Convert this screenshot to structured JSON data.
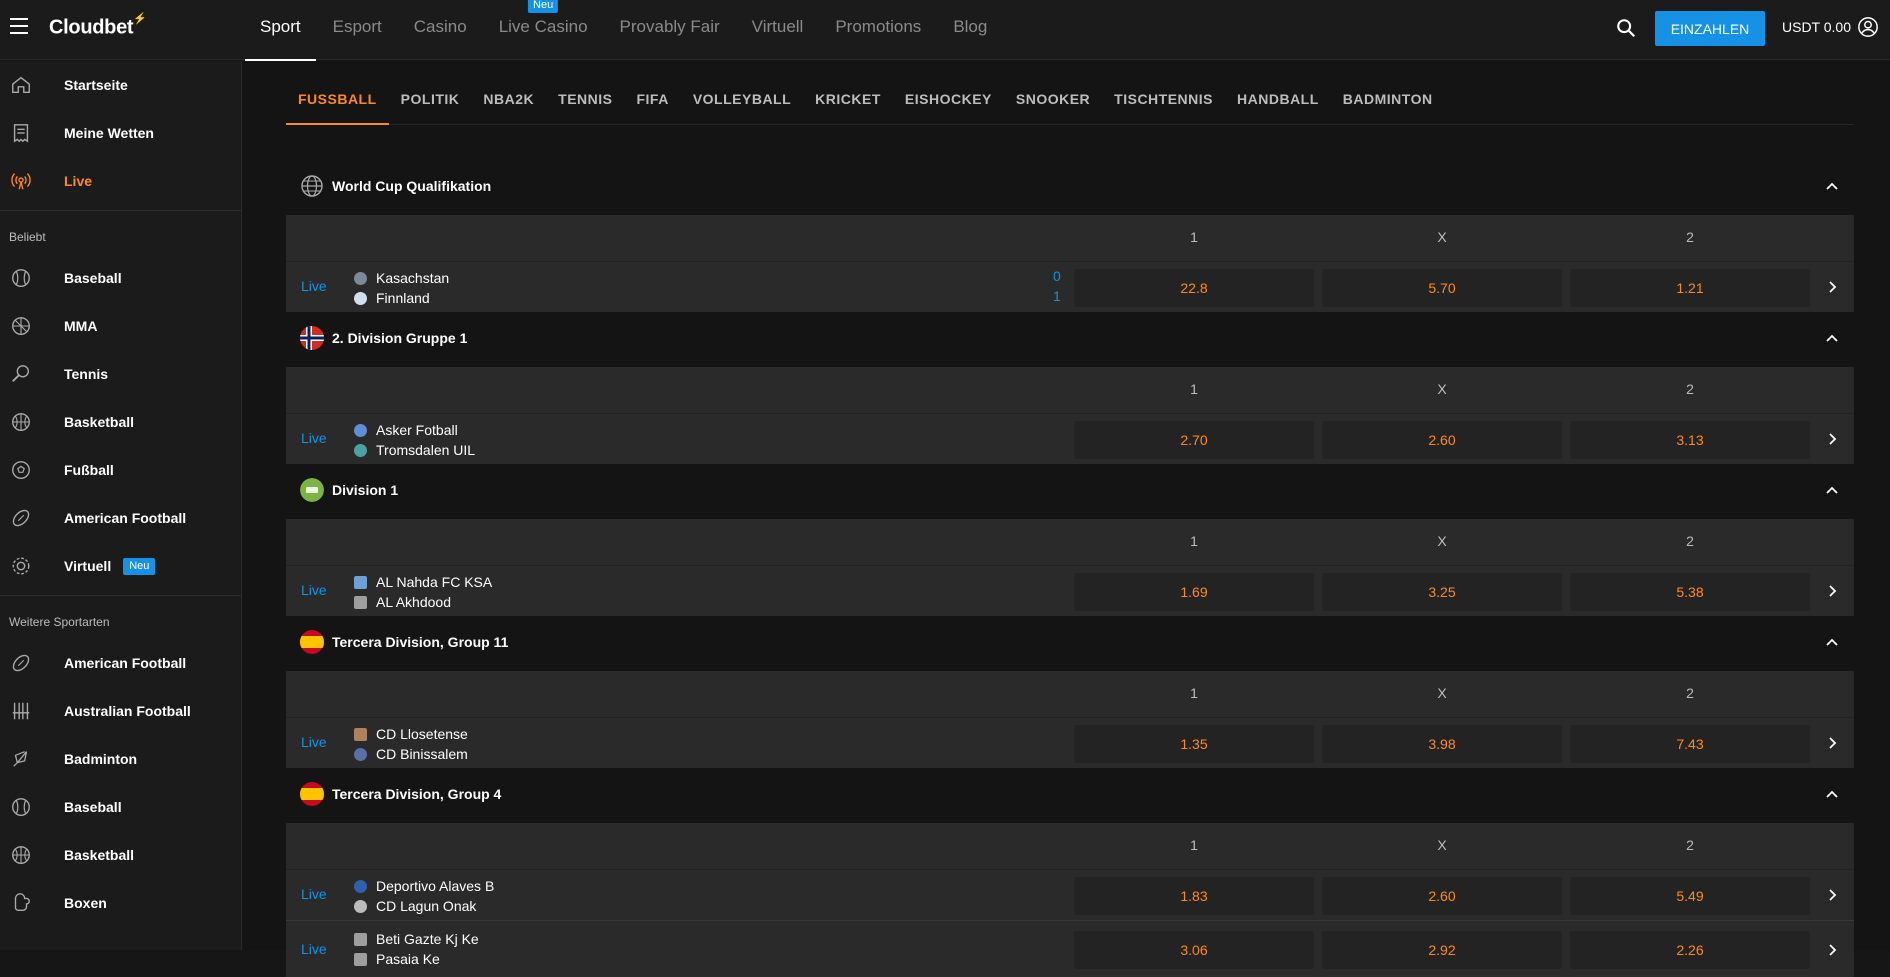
{
  "brand": {
    "name": "Cloudbet",
    "accent": "#ff8a1f",
    "link": "#1591e6"
  },
  "topnav": {
    "items": [
      {
        "label": "Sport",
        "active": true
      },
      {
        "label": "Esport"
      },
      {
        "label": "Casino"
      },
      {
        "label": "Live Casino",
        "badge": "Neu"
      },
      {
        "label": "Provably Fair"
      },
      {
        "label": "Virtuell"
      },
      {
        "label": "Promotions"
      },
      {
        "label": "Blog"
      }
    ],
    "deposit_label": "EINZAHLEN",
    "wallet": "USDT 0.00"
  },
  "sidebar": {
    "top": [
      {
        "label": "Startseite",
        "icon": "home-icon"
      },
      {
        "label": "Meine Wetten",
        "icon": "receipt-icon"
      },
      {
        "label": "Live",
        "icon": "broadcast-icon"
      }
    ],
    "popular_title": "Beliebt",
    "popular": [
      {
        "label": "Baseball",
        "icon": "baseball-icon"
      },
      {
        "label": "MMA",
        "icon": "mma-icon"
      },
      {
        "label": "Tennis",
        "icon": "tennis-icon"
      },
      {
        "label": "Basketball",
        "icon": "basketball-icon"
      },
      {
        "label": "Fußball",
        "icon": "soccer-icon"
      },
      {
        "label": "American Football",
        "icon": "football-icon"
      },
      {
        "label": "Virtuell",
        "icon": "virtual-icon",
        "badge": "Neu"
      }
    ],
    "more_title": "Weitere Sportarten",
    "more": [
      {
        "label": "American Football",
        "icon": "football-icon"
      },
      {
        "label": "Australian Football",
        "icon": "aussie-football-icon"
      },
      {
        "label": "Badminton",
        "icon": "shuttlecock-icon"
      },
      {
        "label": "Baseball",
        "icon": "baseball-icon"
      },
      {
        "label": "Basketball",
        "icon": "basketball-icon"
      },
      {
        "label": "Boxen",
        "icon": "boxing-glove-icon"
      }
    ]
  },
  "subtabs": [
    "FUSSBALL",
    "POLITIK",
    "NBA2K",
    "TENNIS",
    "FIFA",
    "VOLLEYBALL",
    "KRICKET",
    "EISHOCKEY",
    "SNOOKER",
    "TISCHTENNIS",
    "HANDBALL",
    "BADMINTON"
  ],
  "columns": {
    "c1": "1",
    "cx": "X",
    "c2": "2"
  },
  "leagues": [
    {
      "title": "World Cup Qualifikation",
      "flag": "globe-icon",
      "matches": [
        {
          "live": "Live",
          "home": "Kasachstan",
          "away": "Finnland",
          "score_home": "0",
          "score_away": "1",
          "o1": "22.8",
          "ox": "5.70",
          "o2": "1.21"
        }
      ]
    },
    {
      "title": "2. Division Gruppe 1",
      "flag": "norway-flag-icon",
      "matches": [
        {
          "live": "Live",
          "home": "Asker Fotball",
          "away": "Tromsdalen UIL",
          "o1": "2.70",
          "ox": "2.60",
          "o2": "3.13"
        }
      ]
    },
    {
      "title": "Division 1",
      "flag": "saudi-league-icon",
      "matches": [
        {
          "live": "Live",
          "home": "AL Nahda FC KSA",
          "away": "AL Akhdood",
          "o1": "1.69",
          "ox": "3.25",
          "o2": "5.38"
        }
      ]
    },
    {
      "title": "Tercera Division, Group 11",
      "flag": "spain-flag-icon",
      "matches": [
        {
          "live": "Live",
          "home": "CD Llosetense",
          "away": "CD Binissalem",
          "o1": "1.35",
          "ox": "3.98",
          "o2": "7.43"
        }
      ]
    },
    {
      "title": "Tercera Division, Group 4",
      "flag": "spain-flag-icon",
      "matches": [
        {
          "live": "Live",
          "home": "Deportivo Alaves B",
          "away": "CD Lagun Onak",
          "o1": "1.83",
          "ox": "2.60",
          "o2": "5.49"
        },
        {
          "live": "Live",
          "home": "Beti Gazte Kj Ke",
          "away": "Pasaia Ke",
          "o1": "3.06",
          "ox": "2.92",
          "o2": "2.26"
        }
      ]
    }
  ]
}
